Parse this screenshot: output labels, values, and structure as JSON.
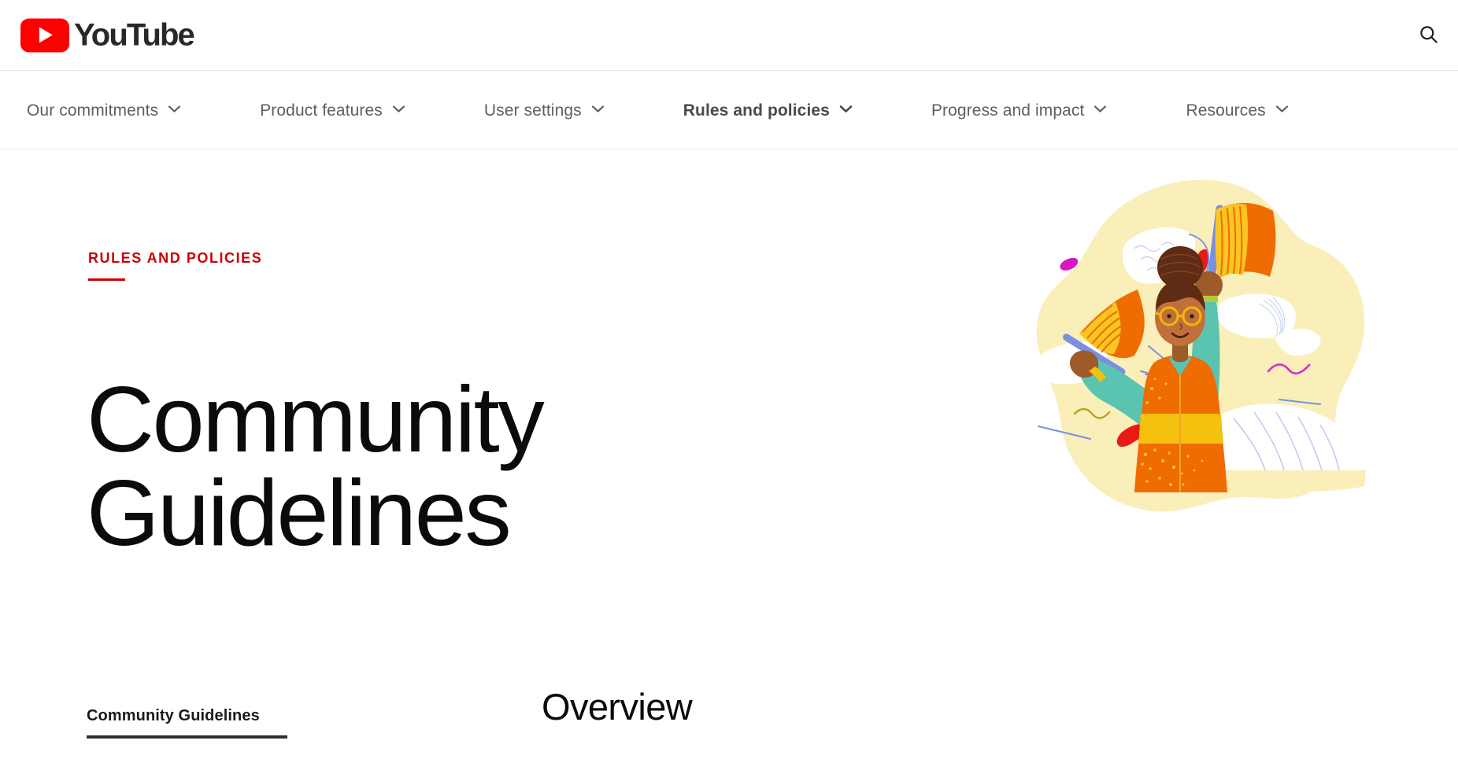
{
  "header": {
    "brand_name": "YouTube",
    "logo_icon": "youtube-play-icon",
    "logo_color": "#FF0000",
    "search_icon": "search-icon"
  },
  "nav": {
    "items": [
      {
        "label": "Our commitments",
        "icon": "chevron-down-icon",
        "active": false
      },
      {
        "label": "Product features",
        "icon": "chevron-down-icon",
        "active": false
      },
      {
        "label": "User settings",
        "icon": "chevron-down-icon",
        "active": false
      },
      {
        "label": "Rules and policies",
        "icon": "chevron-down-icon",
        "active": true
      },
      {
        "label": "Progress and impact",
        "icon": "chevron-down-icon",
        "active": false
      },
      {
        "label": "Resources",
        "icon": "chevron-down-icon",
        "active": false
      }
    ]
  },
  "hero": {
    "eyebrow": "RULES AND POLICIES",
    "eyebrow_color": "#cc0000",
    "title": "Community Guidelines",
    "illustration": {
      "name": "person-waving-flags-illustration",
      "blob_color": "#FAEEB9",
      "flag_color": "#EF6C00",
      "flag_stripe_color": "#F9C623",
      "sleeve_color": "#5BC4B0",
      "dress_color": "#EF6C00",
      "belt_color": "#F4C10F",
      "hair_color": "#5E2B14",
      "skin_color": "#C1703B",
      "pole_color": "#7B8FE0"
    }
  },
  "lower": {
    "sidebar": {
      "items": [
        {
          "label": "Community Guidelines",
          "active": true
        }
      ]
    },
    "content": {
      "section_title": "Overview"
    }
  }
}
